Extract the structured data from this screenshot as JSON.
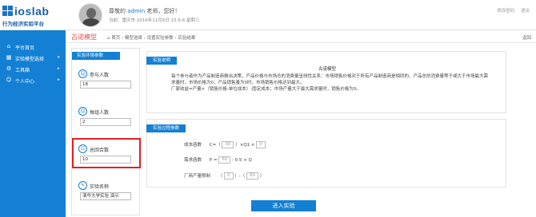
{
  "header": {
    "logo_text": "ioslab",
    "logo_sub": "行为经济实验平台",
    "greeting_prefix": "尊敬的",
    "user_name": "admin",
    "greeting_suffix": "老师，您好！",
    "subline": "当前：重庆市   2016年11月6日 23:6:6 星期三",
    "links": [
      "修改密码",
      "退出"
    ]
  },
  "sidebar": {
    "items": [
      {
        "icon": "home-icon",
        "glyph": "⌂",
        "label": "平台首页",
        "arrow": ""
      },
      {
        "icon": "grid-icon",
        "glyph": "▦",
        "label": "实验模型选择",
        "arrow": "▾"
      },
      {
        "icon": "tools-icon",
        "glyph": "⚙",
        "label": "工具箱",
        "arrow": "▸"
      },
      {
        "icon": "user-icon",
        "glyph": "☺",
        "label": "个人中心",
        "arrow": "▸"
      }
    ]
  },
  "page": {
    "title": "古诺模型",
    "breadcrumb": "⌂ 首页 › 模型选择 › 设置实验参数 › 实验结果",
    "back": "返回"
  },
  "env_panel": {
    "tag": "实验环境参数",
    "fields": [
      {
        "icon": "person-icon",
        "glyph": "☺",
        "label": "参与人数",
        "value": "18"
      },
      {
        "icon": "group-icon",
        "glyph": "☺",
        "label": "每组人数",
        "value": "2"
      },
      {
        "icon": "rounds-icon",
        "glyph": "☷",
        "label": "总回合数",
        "value": "10"
      },
      {
        "icon": "name-icon",
        "glyph": "✎",
        "label": "实验名称",
        "value": "清华大学实验 演示"
      }
    ]
  },
  "intro": {
    "tag": "实验说明",
    "title": "古诺模型",
    "body": "每个参与者作为产品制造商做出决策，产品价格与市场总的消费量呈线性关系：市场销售价格对于所有产品制造商是相同的。产品总的消费量等于或大于市场最大需求量时，市场价格为0；产品销售量为0时，市场销售价格达到最大。",
    "formula": "厂家收益=产量×（销售价格-单位成本）-固定成本；市场产量大于最大需求量时，销售价格为0。"
  },
  "process": {
    "tag": "实验过程参数",
    "cost_label": "成本函数",
    "cost_formula": {
      "pre": "C=（",
      "a": "30",
      "mid": "）×Q1 ×",
      "b": "0",
      "post": ""
    },
    "demand_label": "需求函数",
    "demand_formula": {
      "pre": "P =",
      "a": "60",
      "mid": "- 0.5",
      "b": "",
      "post": "× Q"
    },
    "capacity_label": "厂商产量限制",
    "capacity_formula": {
      "pre": "（",
      "a": "0",
      "mid": "）-（",
      "b": "60",
      "post": "）"
    }
  },
  "submit_label": "进入实验"
}
